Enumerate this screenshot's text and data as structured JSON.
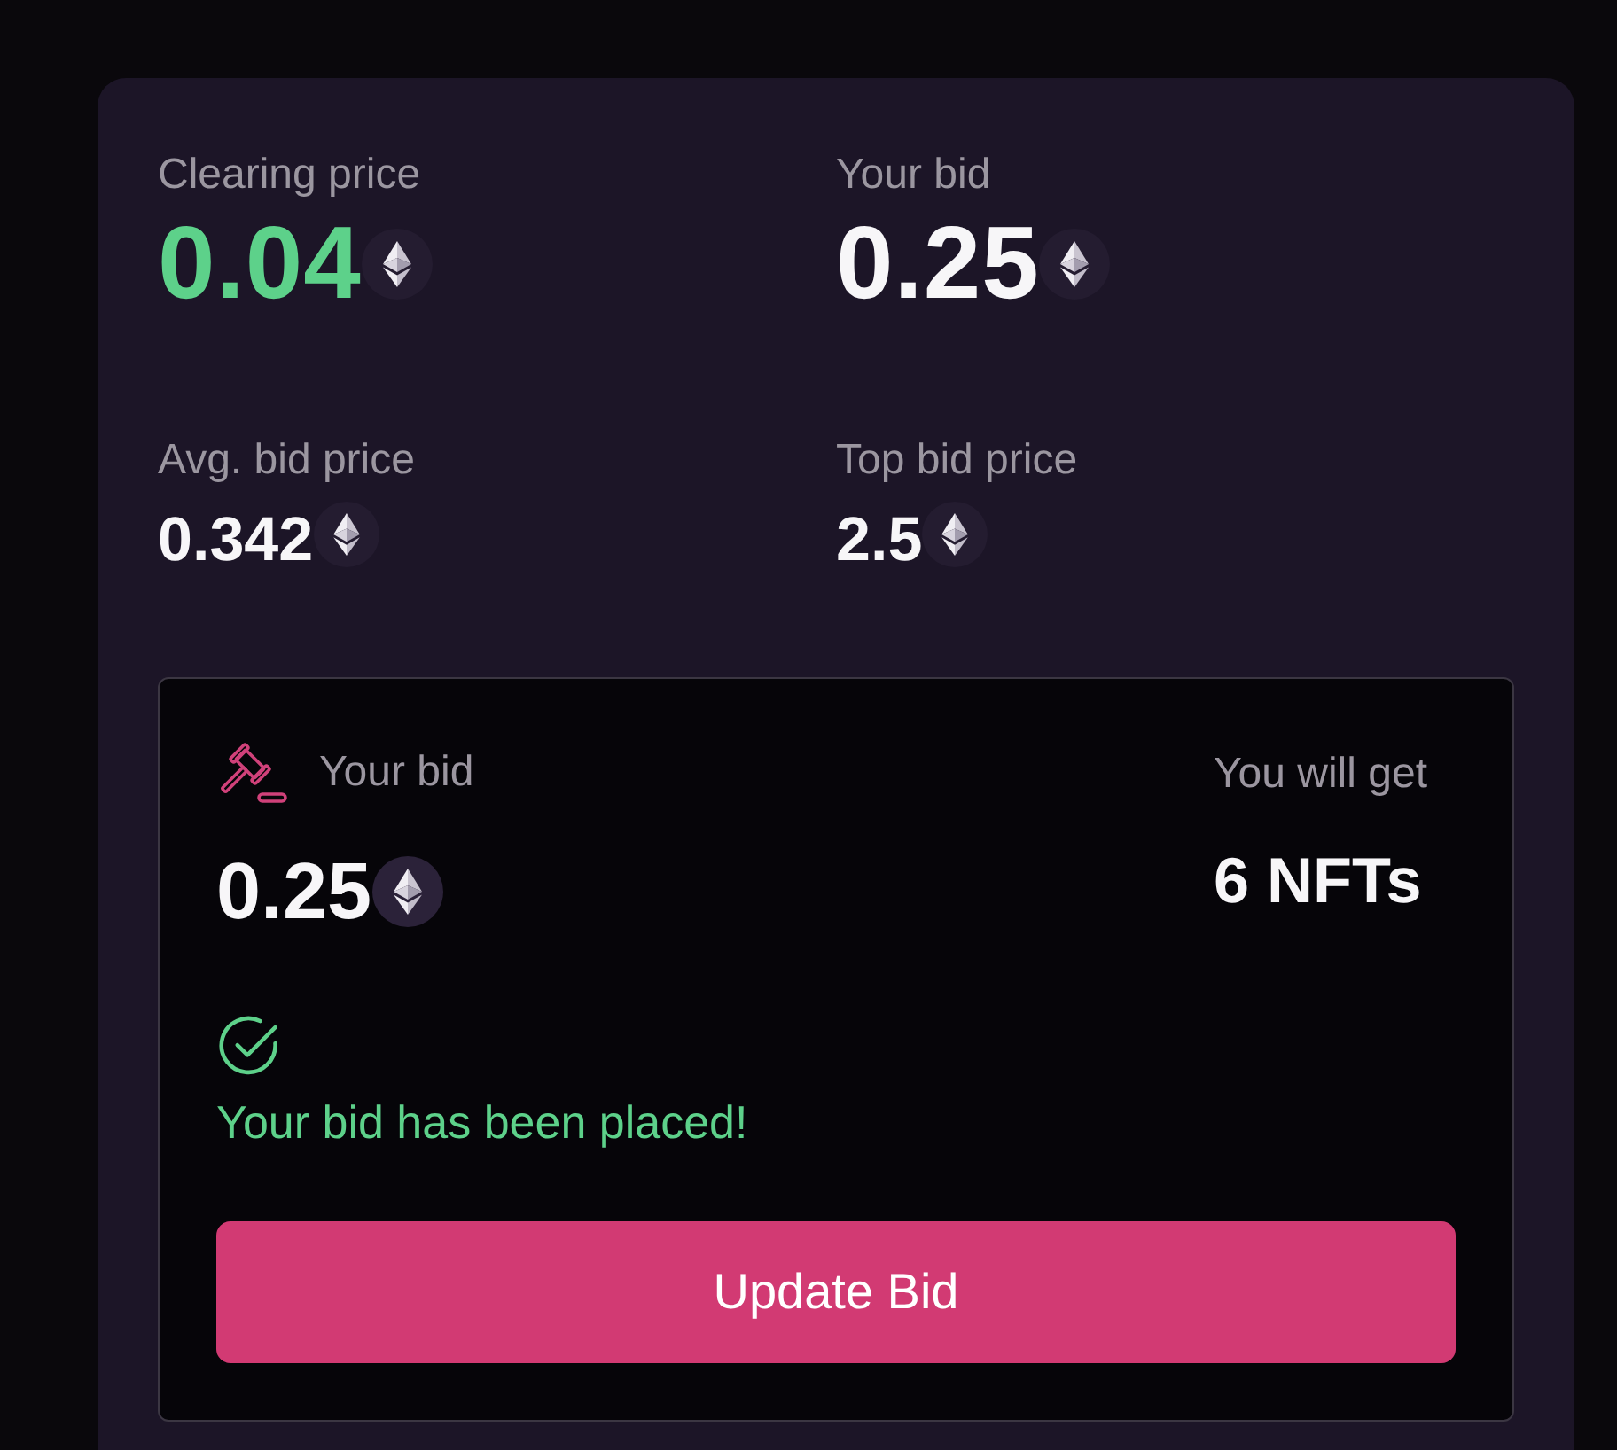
{
  "stats": [
    {
      "kind": "headline",
      "label": "Clearing price",
      "value": "0.04",
      "highlight": true
    },
    {
      "kind": "headline",
      "label": "Your bid",
      "value": "0.25",
      "highlight": false
    },
    {
      "kind": "detail",
      "label": "Avg. bid price",
      "value": "0.342",
      "highlight": false
    },
    {
      "kind": "detail",
      "label": "Top bid price",
      "value": "2.5",
      "highlight": false
    }
  ],
  "bid_panel": {
    "bid_label": "Your bid",
    "bid_value": "0.25",
    "receive_label": "You will get",
    "receive_value": "6 NFTs",
    "status": {
      "kind": "success",
      "message": "Your bid has been placed!"
    },
    "button": "Update Bid"
  }
}
